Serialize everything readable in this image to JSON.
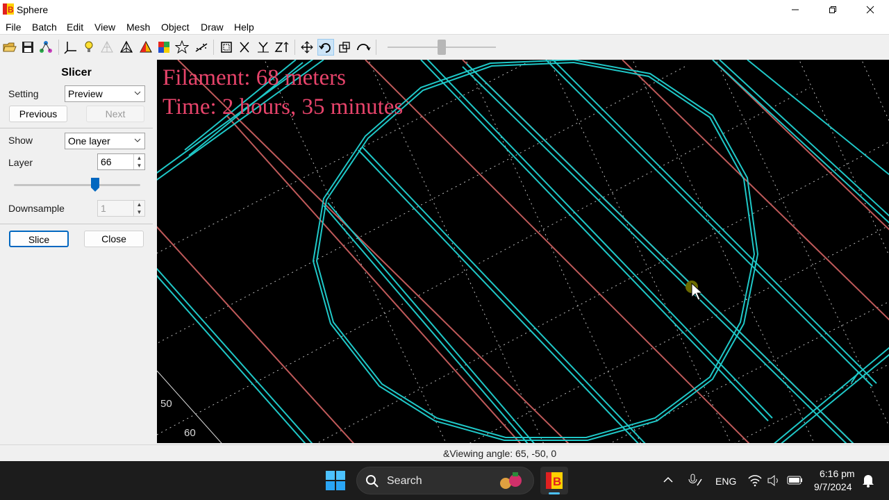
{
  "window": {
    "title": "Sphere"
  },
  "menu": [
    "File",
    "Batch",
    "Edit",
    "View",
    "Mesh",
    "Object",
    "Draw",
    "Help"
  ],
  "panel": {
    "title": "Slicer",
    "setting_label": "Setting",
    "setting_value": "Preview",
    "previous_label": "Previous",
    "next_label": "Next",
    "show_label": "Show",
    "show_value": "One layer",
    "layer_label": "Layer",
    "layer_value": "66",
    "downsample_label": "Downsample",
    "downsample_value": "1",
    "slice_label": "Slice",
    "close_label": "Close"
  },
  "viewport": {
    "filament_text": "Filament: 68 meters",
    "time_text": "Time: 2 hours, 35 minutes",
    "axis_label_1": "50",
    "axis_label_2": "60"
  },
  "status": {
    "viewing_angle": "&Viewing angle: 65, -50, 0"
  },
  "taskbar": {
    "search_placeholder": "Search",
    "language": "ENG",
    "time": "6:16 pm",
    "date": "9/7/2024"
  },
  "colors": {
    "overlay_text": "#e8446b",
    "perimeter": "#1fc8c8",
    "infill_red": "#c05a5a",
    "grid_dots": "#d0d0d0",
    "accent": "#0067c0"
  },
  "icons": {
    "toolbar": [
      "open-folder-icon",
      "save-icon",
      "network-icon",
      "axes-icon",
      "lightbulb-icon",
      "wireframe-icon",
      "mesh-icon",
      "shaded-icon",
      "colormap-icon",
      "star-icon",
      "scatter-icon",
      "select-box-icon",
      "axis-x-icon",
      "axis-y-icon",
      "axis-z-icon",
      "move-icon",
      "rotate-icon",
      "scale-icon",
      "orbit-icon"
    ]
  }
}
